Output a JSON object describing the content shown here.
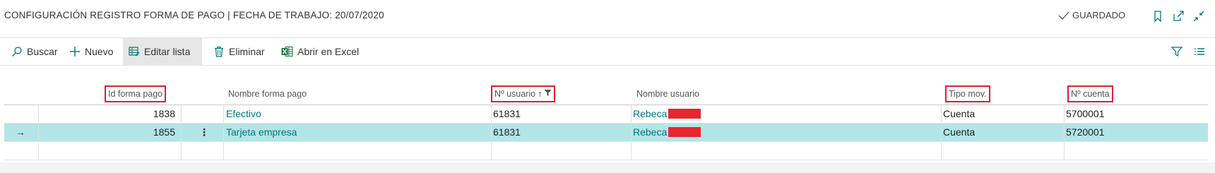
{
  "page": {
    "title": "CONFIGURACIÓN REGISTRO FORMA DE PAGO | FECHA DE TRABAJO: 20/07/2020",
    "status": "GUARDADO"
  },
  "toolbar": {
    "search_label": "Buscar",
    "new_label": "Nuevo",
    "edit_list_label": "Editar lista",
    "delete_label": "Eliminar",
    "excel_label": "Abrir en Excel"
  },
  "table": {
    "headers": {
      "id": "Id forma pago",
      "name": "Nombre forma pago",
      "user_no": "Nº usuario",
      "user_name": "Nombre usuario",
      "mov_type": "Tipo mov.",
      "account_no": "Nº cuenta"
    },
    "sort_arrow": "↑",
    "rows": [
      {
        "id": "1838",
        "name": "Efectivo",
        "user_no": "61831",
        "user_name": "Rebeca",
        "mov_type": "Cuenta",
        "account_no": "5700001"
      },
      {
        "id": "1855",
        "name": "Tarjeta empresa",
        "user_no": "61831",
        "user_name": "Rebeca",
        "mov_type": "Cuenta",
        "account_no": "5720001"
      }
    ],
    "current_row_arrow": "→",
    "row_menu_glyph": "⋮"
  },
  "colors": {
    "accent": "#00787a",
    "selected_row": "#b3e5e7",
    "highlight_box": "#e01e2b",
    "redaction": "#e8262f"
  }
}
